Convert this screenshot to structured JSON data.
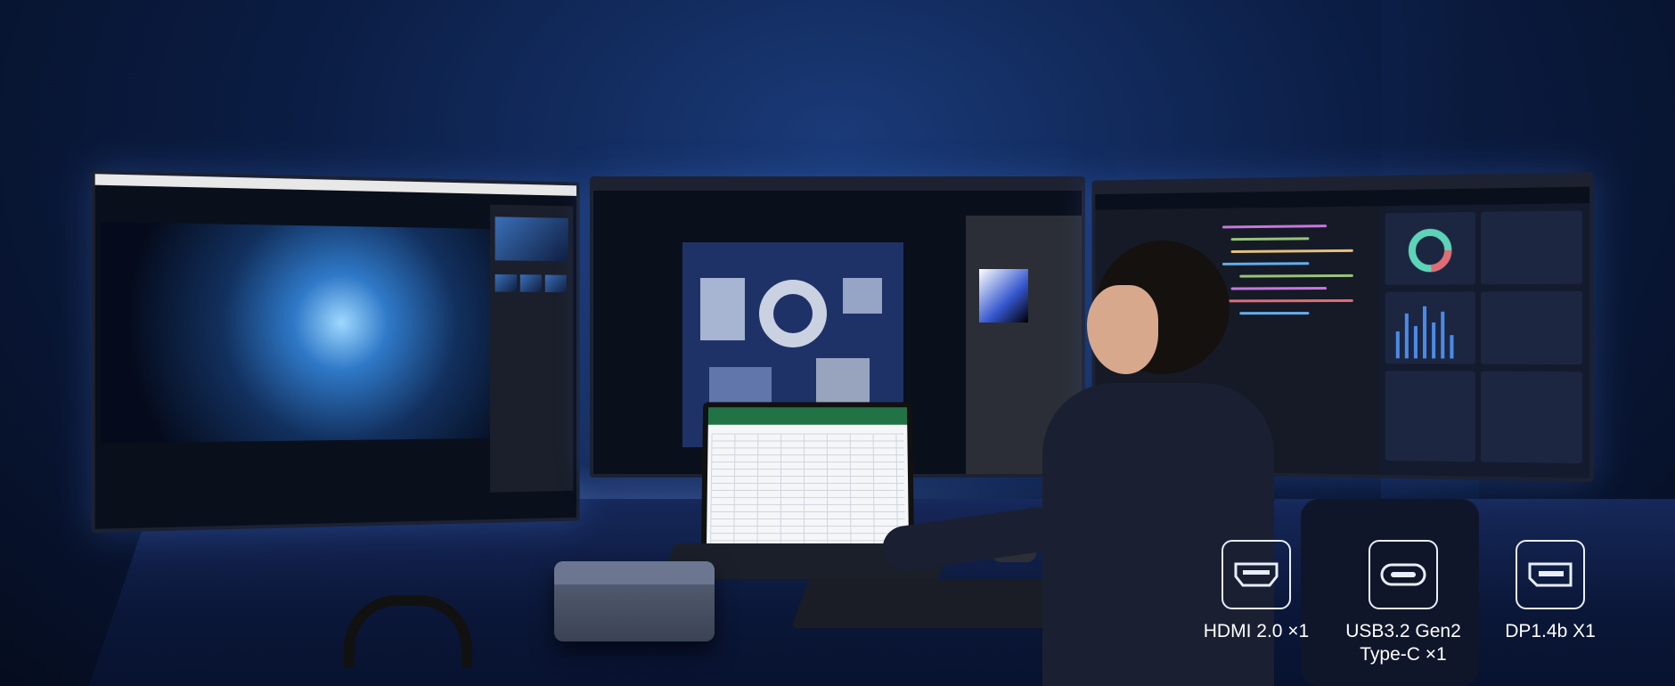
{
  "ports": [
    {
      "name": "hdmi",
      "label": "HDMI 2.0 ×1",
      "icon": "hdmi-port-icon"
    },
    {
      "name": "usbc",
      "label": "USB3.2 Gen2\nType-C ×1",
      "icon": "usb-c-port-icon"
    },
    {
      "name": "dp",
      "label": "DP1.4b X1",
      "icon": "displayport-icon"
    }
  ],
  "colors": {
    "background": "#07112a",
    "accent": "#4a8be8",
    "port_outline": "#e8eefc",
    "text": "#ffffff"
  }
}
